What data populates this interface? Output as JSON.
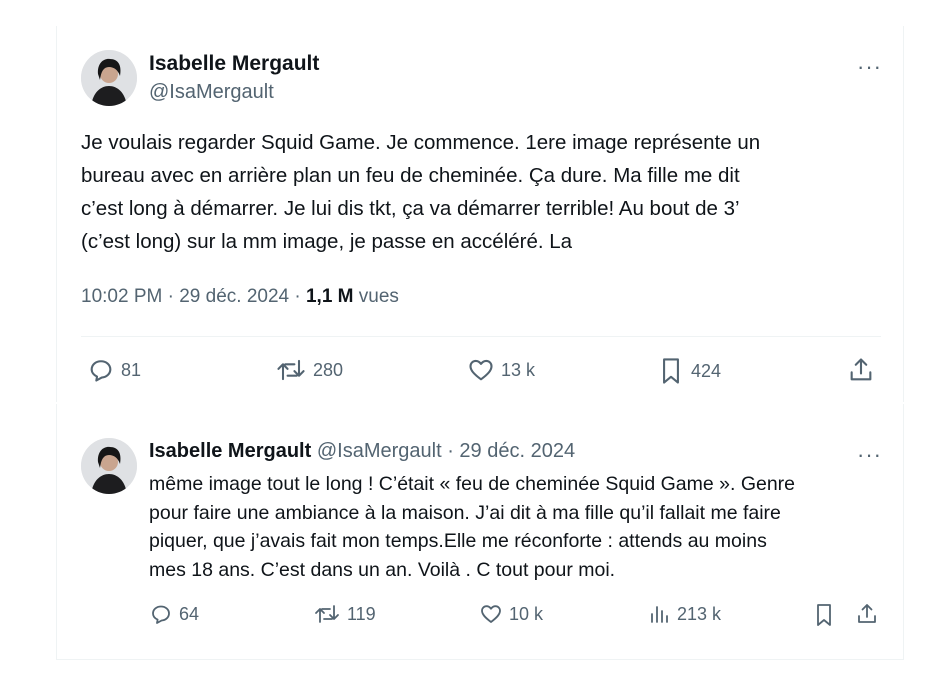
{
  "main_tweet": {
    "author_name": "Isabelle Mergault",
    "handle": "@IsaMergault",
    "more_label": "···",
    "text_lines": [
      "Je voulais regarder Squid Game. Je commence. 1ere image représente un",
      "bureau avec en arrière plan un feu de cheminée. Ça dure. Ma fille me dit",
      "c’est long à démarrer. Je lui dis tkt, ça va démarrer terrible! Au bout de 3’",
      "(c’est long) sur la mm image, je passe en accéléré. La"
    ],
    "time": "10:02 PM",
    "date": "29 déc. 2024",
    "views_count": "1,1 M",
    "views_label": "vues",
    "actions": {
      "replies": "81",
      "reposts": "280",
      "likes": "13 k",
      "bookmarks": "424"
    }
  },
  "reply_tweet": {
    "author_name": "Isabelle Mergault",
    "handle": "@IsaMergault",
    "date": "29 déc. 2024",
    "more_label": "···",
    "text_lines": [
      "même image tout le long ! C’était « feu de cheminée Squid Game ». Genre",
      "pour faire une ambiance à la maison. J’ai dit à ma fille qu’il fallait me faire",
      "piquer, que j’avais fait mon temps.Elle me réconforte : attends au moins",
      "mes 18 ans. C’est dans un an. Voilà . C tout pour moi."
    ],
    "actions": {
      "replies": "64",
      "reposts": "119",
      "likes": "10 k",
      "views": "213 k"
    }
  },
  "icons": [
    "avatar",
    "more-icon",
    "reply-icon",
    "repost-icon",
    "like-icon",
    "bookmark-icon",
    "share-icon",
    "views-icon"
  ]
}
